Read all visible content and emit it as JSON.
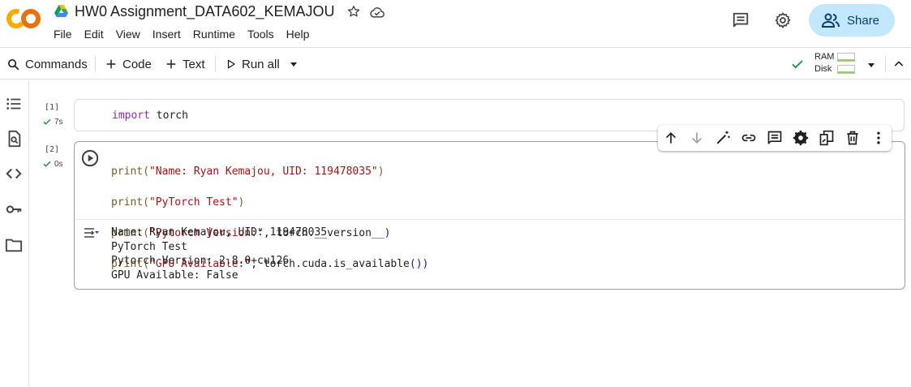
{
  "header": {
    "logo_text": "CO",
    "notebook_title": "HW0 Assignment_DATA602_KEMAJOU",
    "menu": [
      "File",
      "Edit",
      "View",
      "Insert",
      "Runtime",
      "Tools",
      "Help"
    ],
    "share_label": "Share"
  },
  "toolbar": {
    "commands_label": "Commands",
    "code_label": "Code",
    "text_label": "Text",
    "run_all_label": "Run all",
    "ram_label": "RAM",
    "disk_label": "Disk"
  },
  "cells": [
    {
      "exec_count": "[1]",
      "exec_time": "7s",
      "code_lines": [
        {
          "kw": "import",
          "rest": " torch"
        }
      ]
    },
    {
      "exec_count": "[2]",
      "exec_time": "0s",
      "code": {
        "line1_fn": "print(",
        "line1_str": "\"Name: Ryan Kemajou, UID: 119478035\"",
        "line1_end": ")",
        "line2_fn": "print(",
        "line2_str": "\"PyTorch Test\"",
        "line2_end": ")",
        "line3_fn": "print(",
        "line3_str": "\"Pytorch Version:\"",
        "line3_mid": ", torch.__version__",
        "line3_end": ")",
        "line4_fn": "print(",
        "line4_str": "\"GPU Available:\"",
        "line4_mid": ", torch.cuda.is_available",
        "line4_end": "())"
      },
      "output_lines": [
        "Name: Ryan Kemajou, UID: 119478035",
        "PyTorch Test",
        "Pytorch Version: 2.8.0+cu126",
        "GPU Available: False"
      ]
    }
  ],
  "cell_toolbar_icons": [
    "arrow-up-icon",
    "arrow-down-icon",
    "magic-wand-icon",
    "link-icon",
    "comment-icon",
    "gear-icon",
    "mirror-cell-icon",
    "delete-icon",
    "more-vert-icon"
  ],
  "colors": {
    "accent_share": "#c2e7ff",
    "status_ok": "#1e8e3e",
    "logo_orange": "#f9ab00",
    "keyword": "#8a2bb9",
    "string": "#a31515"
  }
}
